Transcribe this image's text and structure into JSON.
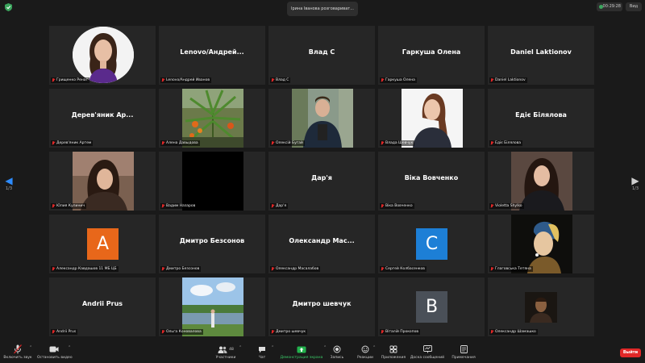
{
  "meeting": {
    "speaking_banner": "Ірина Іванова розговариват...",
    "timer": "00:29:28",
    "view_label": "Вид",
    "page_left": "1/3",
    "page_right": "1/3"
  },
  "tiles": [
    {
      "center_name": "",
      "label": "Грищенко Ренат"
    },
    {
      "center_name": "Lenovo/Андрей...",
      "label": "Lenovo/Андрей Иванов"
    },
    {
      "center_name": "Влад С",
      "label": "Влад С"
    },
    {
      "center_name": "Гаркуша Олена",
      "label": "Гаркуша Олена"
    },
    {
      "center_name": "Daniel Laktionov",
      "label": "Daniel Laktionov"
    },
    {
      "center_name": "Дерев'яник Ар...",
      "label": "Дерев'яник Артем"
    },
    {
      "center_name": "",
      "label": "Алена Давыдова"
    },
    {
      "center_name": "",
      "label": "Олексій Бугай"
    },
    {
      "center_name": "",
      "label": "Влада Шевчук"
    },
    {
      "center_name": "Едіє Білялова",
      "label": "Едіє Білялова"
    },
    {
      "center_name": "",
      "label": "Юлия Кулинич"
    },
    {
      "center_name": "",
      "label": "Вадим Назаров"
    },
    {
      "center_name": "Дар'я",
      "label": "Дар'я"
    },
    {
      "center_name": "Віка Вовченко",
      "label": "Віка Вовченко"
    },
    {
      "center_name": "",
      "label": "Violetta Shylko"
    },
    {
      "center_name": "",
      "label": "Александр Кавдашов 11 МБ ЦБ",
      "avatar_letter": "A"
    },
    {
      "center_name": "Дмитро Безсонов",
      "label": "Дмитро Безсонов"
    },
    {
      "center_name": "Олександр Мас...",
      "label": "Олександр Масалабов"
    },
    {
      "center_name": "",
      "label": "Сергей Колбасенков",
      "avatar_letter": "C"
    },
    {
      "center_name": "",
      "label": "Глаговська Тетяна"
    },
    {
      "center_name": "Andrii Prus",
      "label": "Andrii Prus"
    },
    {
      "center_name": "",
      "label": "Ольга Коновалова"
    },
    {
      "center_name": "Дмитро шевчук",
      "label": "Дмитро шевчук"
    },
    {
      "center_name": "",
      "label": "Віталій Прокопов",
      "avatar_letter": "B"
    },
    {
      "center_name": "",
      "label": "Олександр Шамашко"
    }
  ],
  "toolbar": {
    "unmute": "Включить звук",
    "stop_video": "Остановить видео",
    "participants": "Участники",
    "participants_count": "48",
    "chat": "Чат",
    "share_screen": "Демонстрация экрана",
    "record": "Запись",
    "reactions": "Реакции",
    "apps": "Приложения",
    "whiteboard": "Доска сообщений",
    "notes": "Примечания",
    "end": "Выйти"
  },
  "colors": {
    "avatar_a": "#e8671a",
    "avatar_c": "#1d7fd6",
    "avatar_b": "#4a5058",
    "share_green": "#22b24c",
    "end_red": "#e02828",
    "accent_blue": "#2d8cff"
  }
}
